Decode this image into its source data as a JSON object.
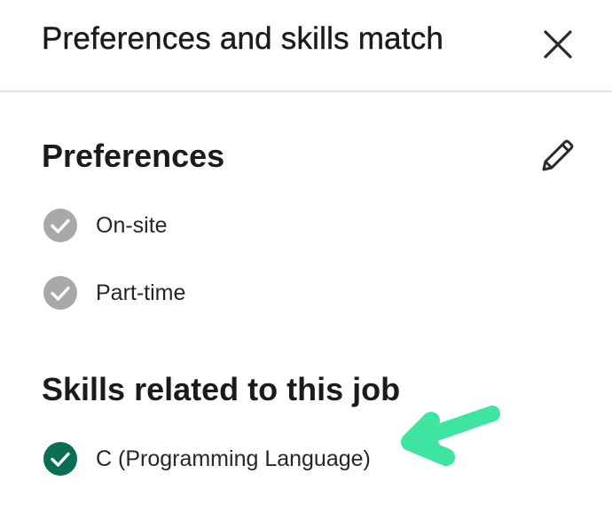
{
  "header": {
    "title": "Preferences and skills match"
  },
  "preferences": {
    "heading": "Preferences",
    "items": [
      {
        "label": "On-site"
      },
      {
        "label": "Part-time"
      }
    ]
  },
  "skills": {
    "heading": "Skills related to this job",
    "items": [
      {
        "label": "C (Programming Language)"
      }
    ]
  },
  "icons": {
    "close": "close-icon",
    "edit": "pencil-icon",
    "preference_check": "check-circle-icon",
    "skill_check": "check-circle-icon",
    "annotation": "arrow-icon"
  },
  "colors": {
    "preference_check": "#a8a8a8",
    "skill_check": "#0a6e54",
    "annotation_arrow": "#3ee5a0"
  }
}
